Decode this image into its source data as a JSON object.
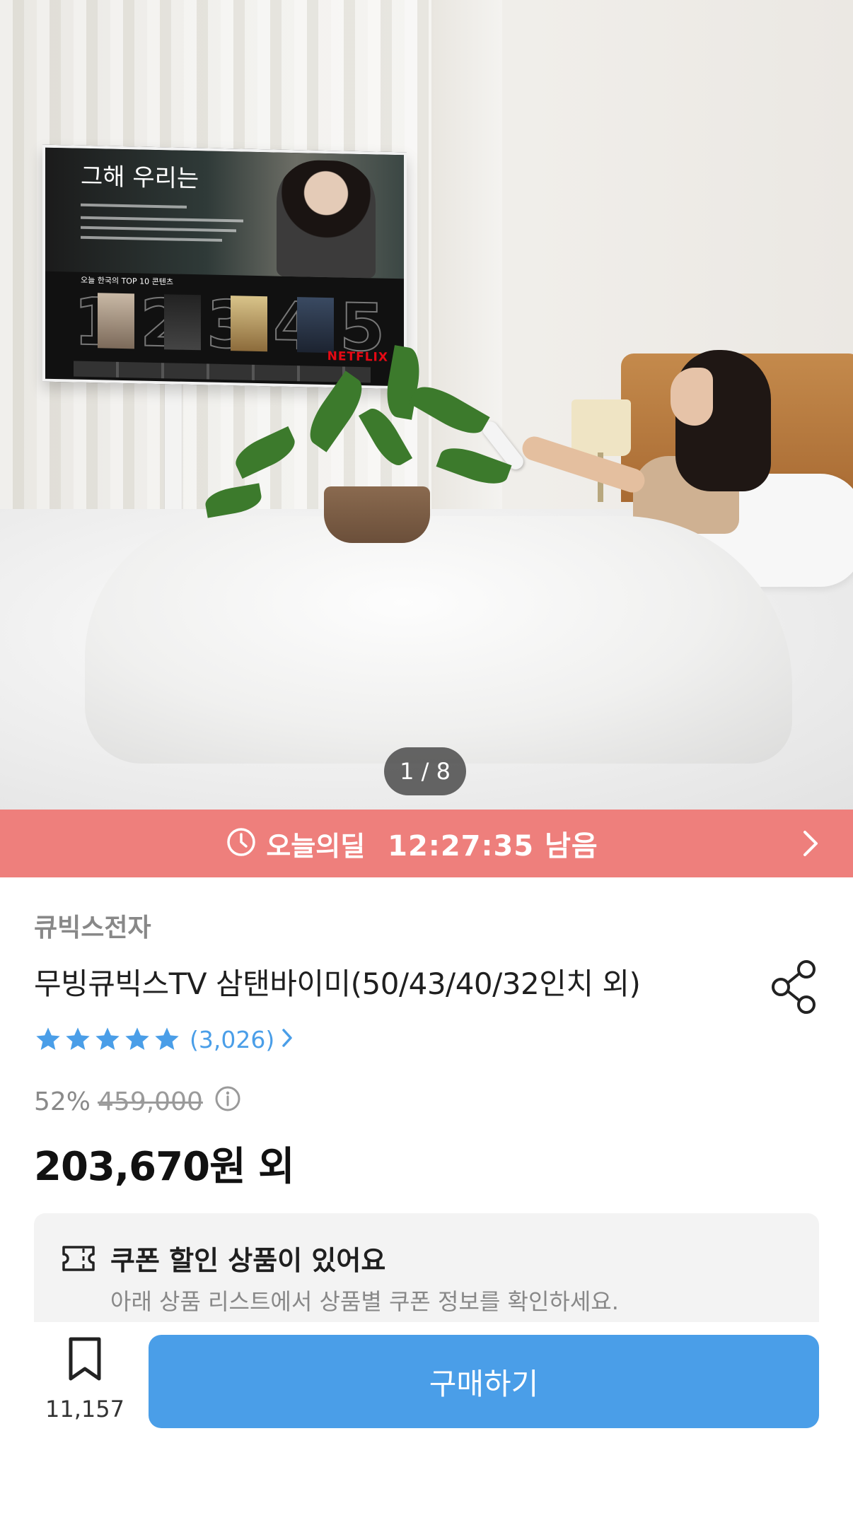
{
  "image": {
    "tv_title": "그해 우리는",
    "tv_row_label": "오늘 한국의 TOP 10 콘텐츠",
    "tv_numbers": [
      "1",
      "2",
      "3",
      "4",
      "5"
    ],
    "tv_brand": "NETFLIX",
    "pager": "1 / 8"
  },
  "deal": {
    "label": "오늘의딜",
    "time": "12:27:35 남음",
    "clock_icon": "clock-icon",
    "chevron_icon": "chevron-right-icon"
  },
  "product": {
    "brand": "큐빅스전자",
    "title": "무빙큐빅스TV 삼탠바이미(50/43/40/32인치 외)",
    "rating": 5,
    "review_count": "(3,026)",
    "discount": "52%",
    "original_price": "459,000",
    "price": "203,670원 외"
  },
  "coupon": {
    "title": "쿠폰 할인 상품이 있어요",
    "description": "아래 상품 리스트에서 상품별 쿠폰 정보를 확인하세요."
  },
  "bottom": {
    "wish_count": "11,157",
    "buy_label": "구매하기"
  },
  "colors": {
    "deal_bg": "#ee7f7c",
    "accent": "#4a9ee8"
  }
}
